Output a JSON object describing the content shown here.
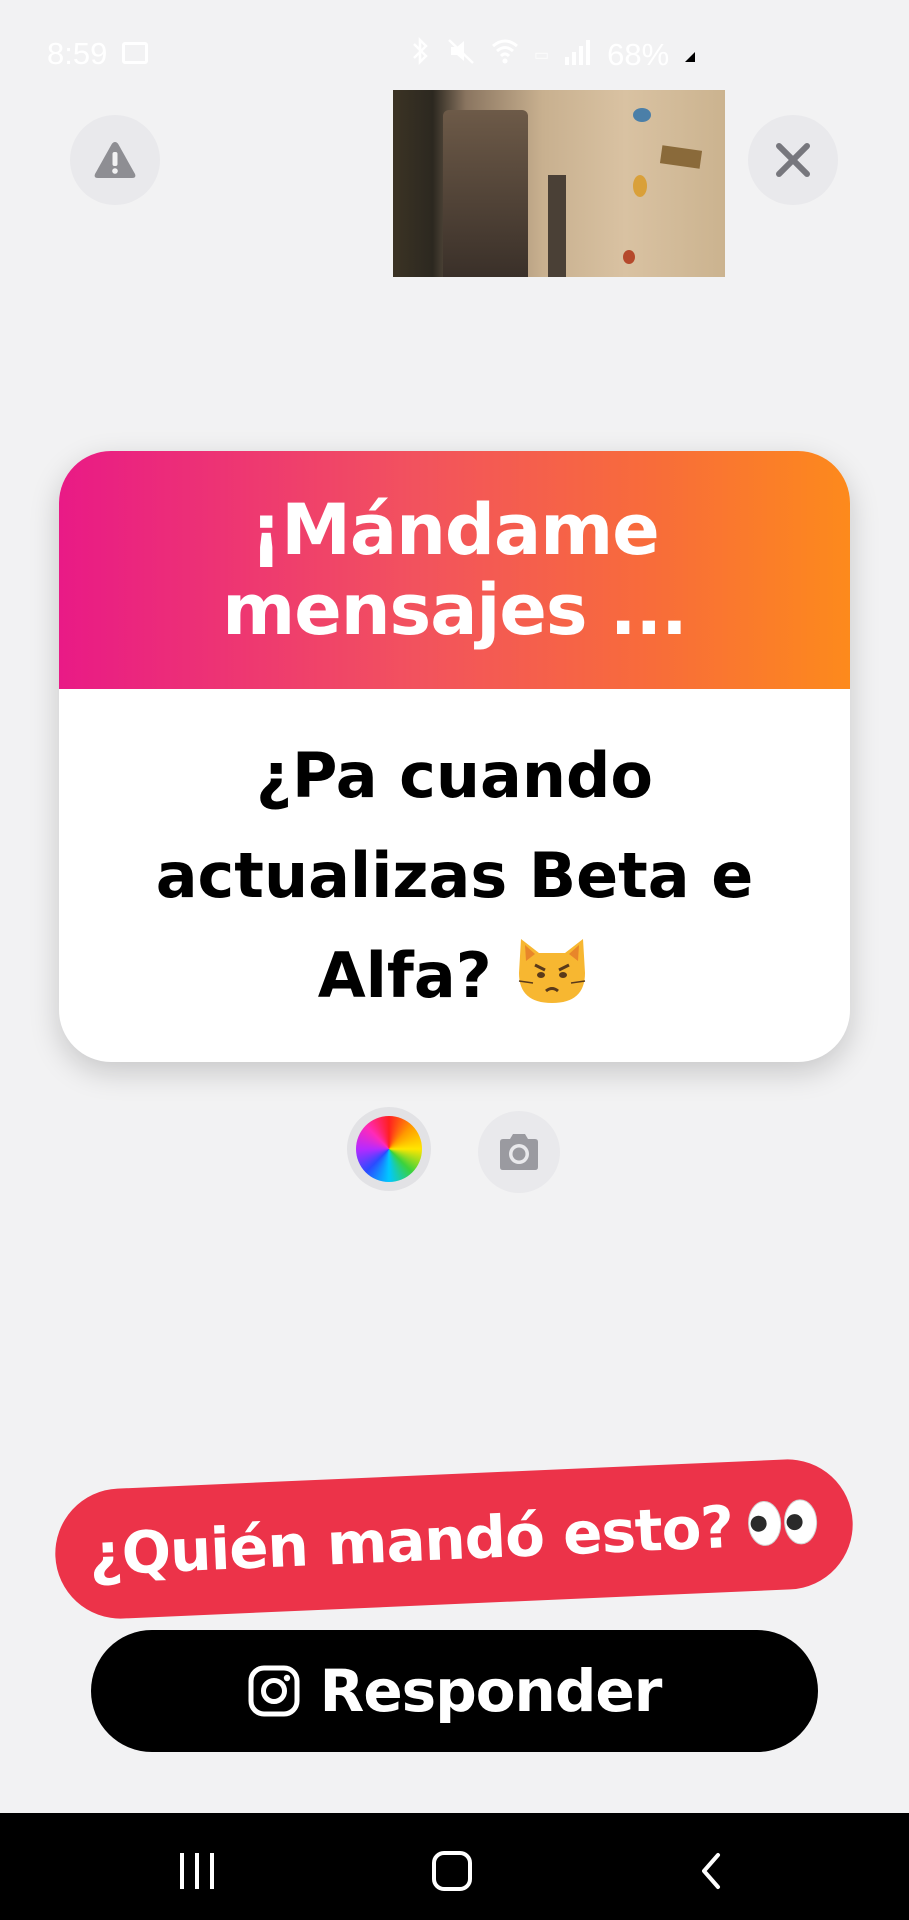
{
  "status_bar": {
    "time": "8:59",
    "battery": "68%"
  },
  "header": {
    "report_icon": "warning-icon",
    "close_icon": "close-icon",
    "thumbnail": "story-thumbnail"
  },
  "card": {
    "title": "¡Mándame mensajes ...",
    "message": "¿Pa cuando actualizas Beta e Alfa?",
    "emoji": "angry-cat-emoji",
    "gradient_start": "#e91a86",
    "gradient_end": "#fd8a1c"
  },
  "controls": {
    "color_icon": "color-wheel-icon",
    "camera_icon": "camera-icon"
  },
  "who_banner": {
    "text": "¿Quién mandó esto?",
    "emoji": "eyes-emoji",
    "color": "#ec3349"
  },
  "reply_button": {
    "label": "Responder",
    "icon": "instagram-icon"
  },
  "nav_bar": {
    "recent_icon": "recent-apps-icon",
    "home_icon": "home-icon",
    "back_icon": "back-icon"
  }
}
